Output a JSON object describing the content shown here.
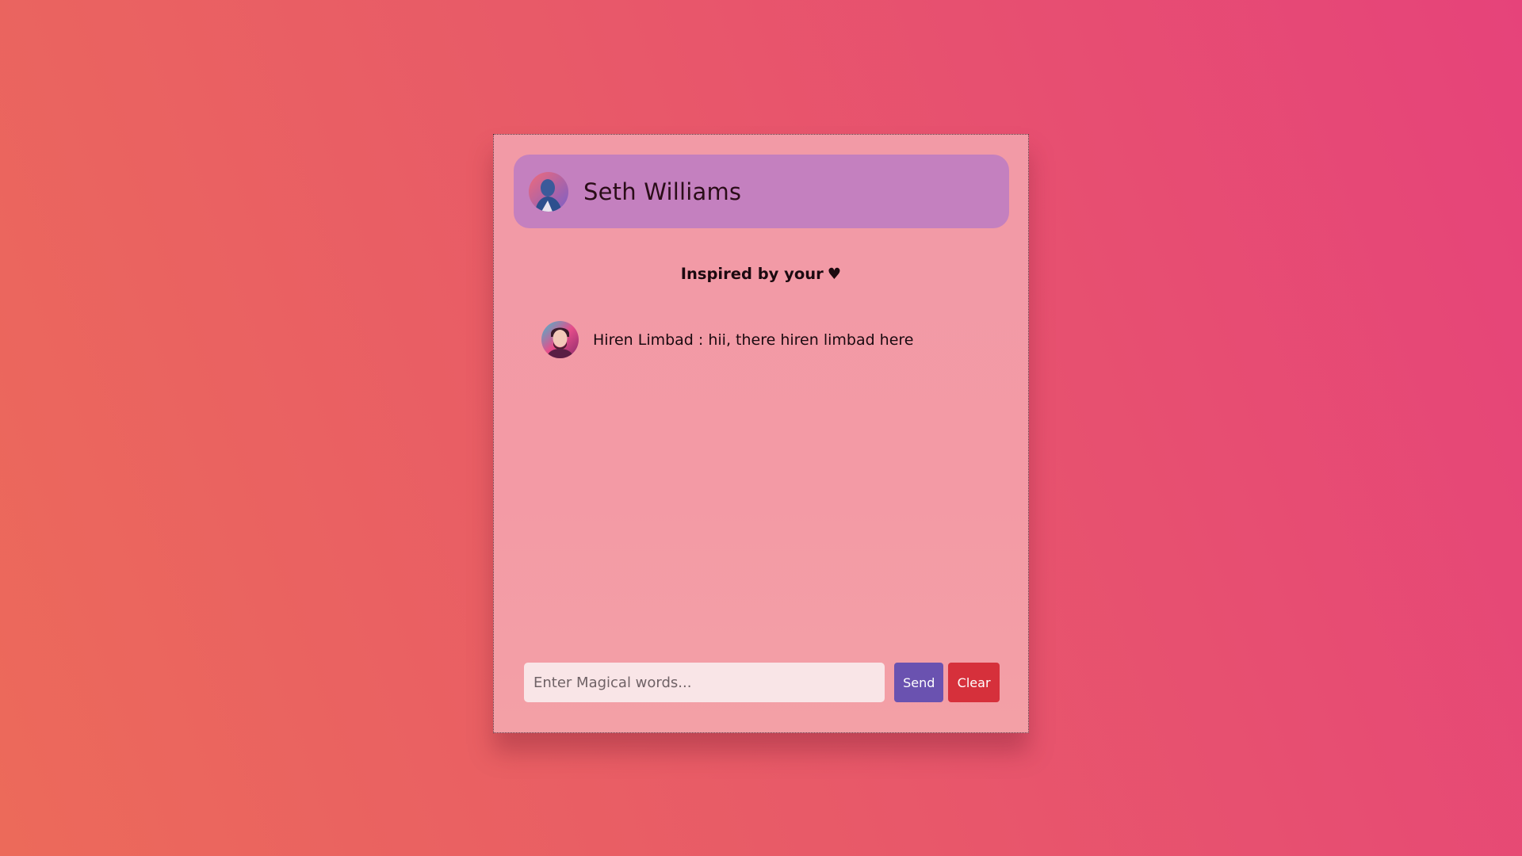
{
  "header": {
    "contact_name": "Seth Williams"
  },
  "tagline": {
    "text": "Inspired by your",
    "heart": "♥"
  },
  "messages": [
    {
      "text": "Hiren Limbad : hii, there hiren limbad here"
    }
  ],
  "composer": {
    "placeholder": "Enter Magical words...",
    "value": "",
    "send_label": "Send",
    "clear_label": "Clear"
  },
  "colors": {
    "header_bg": "#c480bf",
    "send_button": "#6a52b0",
    "clear_button": "#d6303b",
    "card_bg": "#f29aa6"
  }
}
